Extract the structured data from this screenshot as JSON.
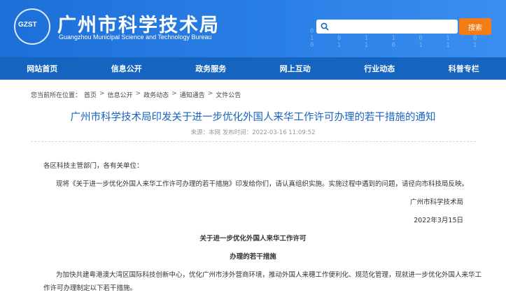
{
  "header": {
    "logo_abbr": "GZST",
    "title": "广州市科学技术局",
    "subtitle": "Guangzhou Municipal Science and Technology Bureau",
    "search_placeholder": "",
    "search_button": "搜索",
    "colors": {
      "brand": "#2a7fe6",
      "nav": "#1565c0",
      "search_button": "#f37c16",
      "title_blue": "#1a63c2"
    }
  },
  "nav": {
    "items": [
      "网站首页",
      "信息公开",
      "政务服务",
      "网上互动",
      "行业动态",
      "科普专栏"
    ]
  },
  "breadcrumb": {
    "prefix": "您当前所在位置：",
    "items": [
      "首页",
      "信息公开",
      "政务动态",
      "通知通告",
      "文件公告"
    ],
    "separator": ">"
  },
  "article": {
    "title": "广州市科学技术局印发关于进一步优化外国人来华工作许可办理的若干措施的通知",
    "meta": "来源：本网 发布时间：2022-03-16 11:09:52",
    "salutation": "各区科技主管部门，各有关单位：",
    "para1": "现将《关于进一步优化外国人来华工作许可办理的若干措施》印发给你们，请认真组织实施。实施过程中遇到的问题，请径向市科技局反映。",
    "signature": "广州市科学技术局",
    "date": "2022年3月15日",
    "doc_title_line1": "关于进一步优化外国人来华工作许可",
    "doc_title_line2": "办理的若干措施",
    "para2_line1": "为加快共建粤港澳大湾区国际科技创新中心，优化广州市涉外营商环境，推动外国人来穗工作便利化、规范化管理，现就进一步优化外国人来华工",
    "para2_line2": "作许可办理制定以下若干措施。"
  }
}
